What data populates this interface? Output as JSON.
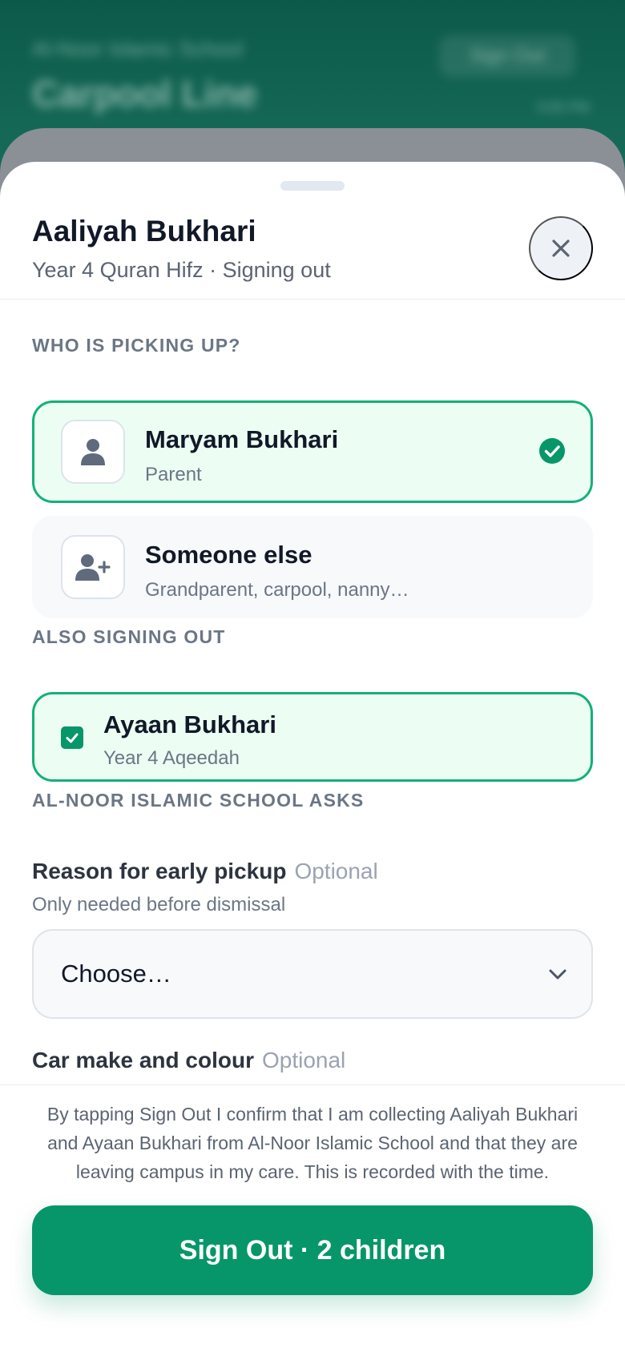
{
  "background": {
    "school_name": "Al-Noor Islamic School",
    "title": "Carpool Line",
    "sign_out_button": "Sign Out",
    "time": "3:05 PM"
  },
  "sheet": {
    "student_name": "Aaliyah Bukhari",
    "subtitle": "Year 4 Quran Hifz · Signing out",
    "close_icon": "close-icon"
  },
  "pickup": {
    "section_label": "WHO IS PICKING UP?",
    "options": [
      {
        "title": "Maryam Bukhari",
        "subtitle": "Parent",
        "icon": "person-icon",
        "selected": true
      },
      {
        "title": "Someone else",
        "subtitle": "Grandparent, carpool, nanny…",
        "icon": "person-add-icon",
        "selected": false
      }
    ]
  },
  "siblings": {
    "section_label": "ALSO SIGNING OUT",
    "items": [
      {
        "name": "Ayaan Bukhari",
        "class": "Year 4 Aqeedah",
        "checked": true
      }
    ]
  },
  "questions": {
    "section_label": "AL-NOOR ISLAMIC SCHOOL ASKS",
    "reason": {
      "label": "Reason for early pickup",
      "optional": "Optional",
      "help": "Only needed before dismissal",
      "value": "Choose…"
    },
    "car": {
      "label": "Car make and colour",
      "optional": "Optional"
    }
  },
  "footer": {
    "consent": "By tapping Sign Out I confirm that I am collecting Aaliyah Bukhari and Ayaan Bukhari from Al-Noor Islamic School and that they are leaving campus in my care. This is recorded with the time.",
    "button_label": "Sign Out · 2 children"
  },
  "colors": {
    "accent": "#079669",
    "accent_border": "#12b179",
    "selected_bg": "#ecfdf3"
  }
}
